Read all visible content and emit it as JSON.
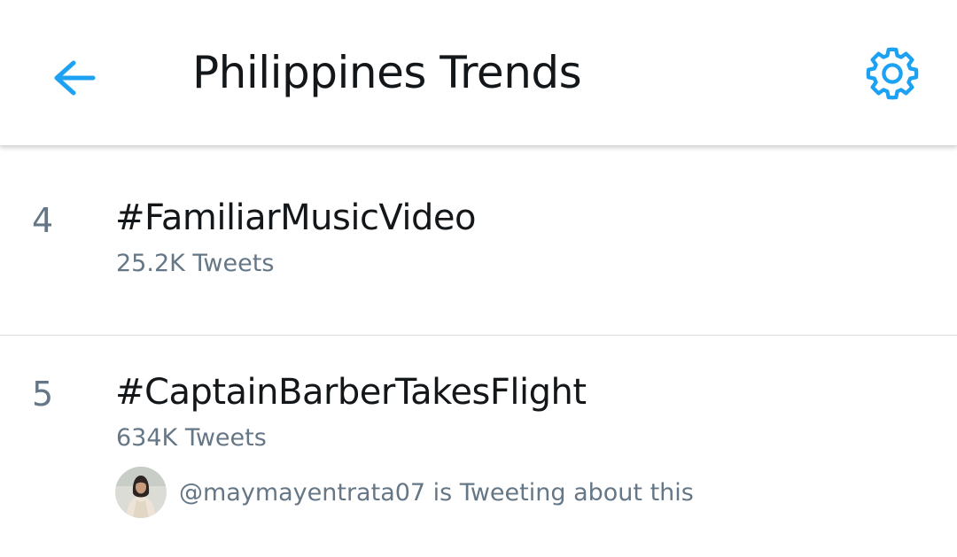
{
  "header": {
    "title": "Philippines Trends",
    "back_icon": "arrow-left-icon",
    "settings_icon": "gear-icon"
  },
  "trends": [
    {
      "rank": "4",
      "name": "#FamiliarMusicVideo",
      "count": "25.2K Tweets"
    },
    {
      "rank": "5",
      "name": "#CaptainBarberTakesFlight",
      "count": "634K Tweets",
      "context": "@maymayentrata07 is Tweeting about this"
    }
  ],
  "colors": {
    "accent": "#1da1f2",
    "primary_text": "#14171a",
    "secondary_text": "#657786",
    "divider": "#d8dde1"
  }
}
